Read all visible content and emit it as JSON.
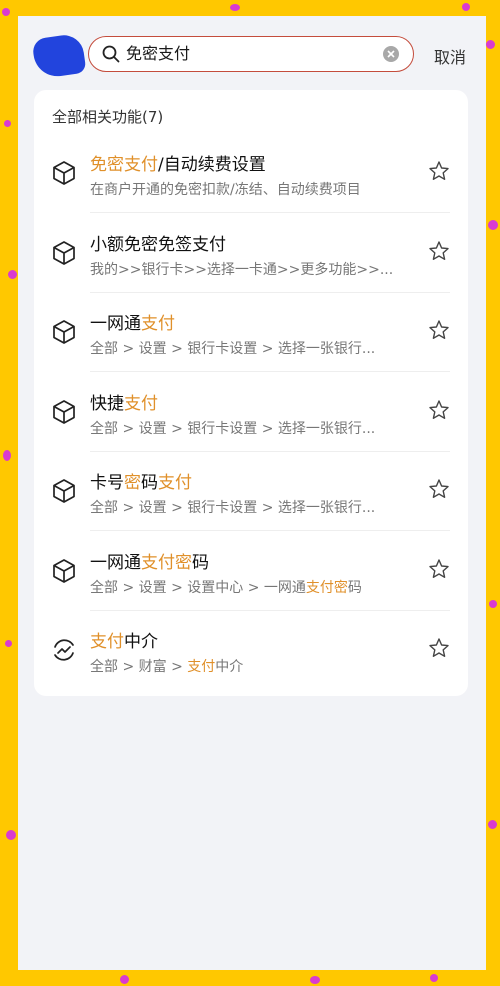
{
  "search": {
    "query": "免密支付"
  },
  "cancel_label": "取消",
  "results_header": "全部相关功能(7)",
  "accent_color": "#e0902a",
  "results": [
    {
      "icon": "box-icon",
      "title": [
        {
          "t": "免密支付",
          "h": true
        },
        {
          "t": "/自动续费设置",
          "h": false
        }
      ],
      "subtitle": [
        {
          "t": "在商户开通的免密扣款/冻结、自动续费项目",
          "h": false
        }
      ]
    },
    {
      "icon": "box-icon",
      "title": [
        {
          "t": "小额免密免签支付",
          "h": false
        }
      ],
      "subtitle": [
        {
          "t": "我的>>银行卡>>选择一卡通>>更多功能>>...",
          "h": false
        }
      ]
    },
    {
      "icon": "box-icon",
      "title": [
        {
          "t": "一网通",
          "h": false
        },
        {
          "t": "支付",
          "h": true
        }
      ],
      "subtitle": [
        {
          "t": "全部 > 设置 > 银行卡设置 > 选择一张银行...",
          "h": false
        }
      ]
    },
    {
      "icon": "box-icon",
      "title": [
        {
          "t": "快捷",
          "h": false
        },
        {
          "t": "支付",
          "h": true
        }
      ],
      "subtitle": [
        {
          "t": "全部 > 设置 > 银行卡设置 > 选择一张银行...",
          "h": false
        }
      ]
    },
    {
      "icon": "box-icon",
      "title": [
        {
          "t": "卡号",
          "h": false
        },
        {
          "t": "密",
          "h": true
        },
        {
          "t": "码",
          "h": false
        },
        {
          "t": "支付",
          "h": true
        }
      ],
      "subtitle": [
        {
          "t": "全部 > 设置 > 银行卡设置 > 选择一张银行...",
          "h": false
        }
      ]
    },
    {
      "icon": "box-icon",
      "title": [
        {
          "t": "一网通",
          "h": false
        },
        {
          "t": "支付密",
          "h": true
        },
        {
          "t": "码",
          "h": false
        }
      ],
      "subtitle": [
        {
          "t": "全部 > 设置 > 设置中心 > 一网通",
          "h": false
        },
        {
          "t": "支付密",
          "h": true
        },
        {
          "t": "码",
          "h": false
        }
      ]
    },
    {
      "icon": "trend-cycle-icon",
      "title": [
        {
          "t": "支付",
          "h": true
        },
        {
          "t": "中介",
          "h": false
        }
      ],
      "subtitle": [
        {
          "t": "全部 > 财富 > ",
          "h": false
        },
        {
          "t": "支付",
          "h": true
        },
        {
          "t": "中介",
          "h": false
        }
      ]
    }
  ]
}
